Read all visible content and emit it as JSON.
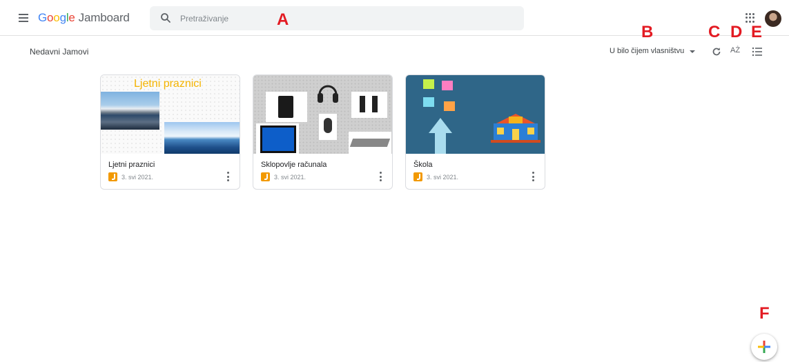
{
  "header": {
    "logo_google": [
      "G",
      "o",
      "o",
      "g",
      "l",
      "e"
    ],
    "product": "Jamboard",
    "search_placeholder": "Pretraživanje"
  },
  "toolbar": {
    "section_title": "Nedavni Jamovi",
    "owner_filter": "U bilo čijem vlasništvu",
    "sort_label": "AŻ"
  },
  "cards": [
    {
      "title": "Ljetni praznici",
      "date": "3. svi 2021.",
      "thumb_text": "Ljetni praznici"
    },
    {
      "title": "Sklopovlje računala",
      "date": "3. svi 2021."
    },
    {
      "title": "Škola",
      "date": "3. svi 2021."
    }
  ],
  "annotations": {
    "A": "A",
    "B": "B",
    "C": "C",
    "D": "D",
    "E": "E",
    "F": "F"
  },
  "colors": {
    "accent_annotation": "#e31b23",
    "jam_orange": "#f29900",
    "thumb_title_yellow": "#f5b400",
    "school_bg": "#2f6688"
  },
  "icons": {
    "menu": "hamburger-menu-icon",
    "search": "search-icon",
    "apps": "apps-grid-icon",
    "refresh": "refresh-icon",
    "sort": "sort-az-icon",
    "view": "list-view-icon",
    "more": "more-vertical-icon",
    "new": "plus-icon"
  }
}
